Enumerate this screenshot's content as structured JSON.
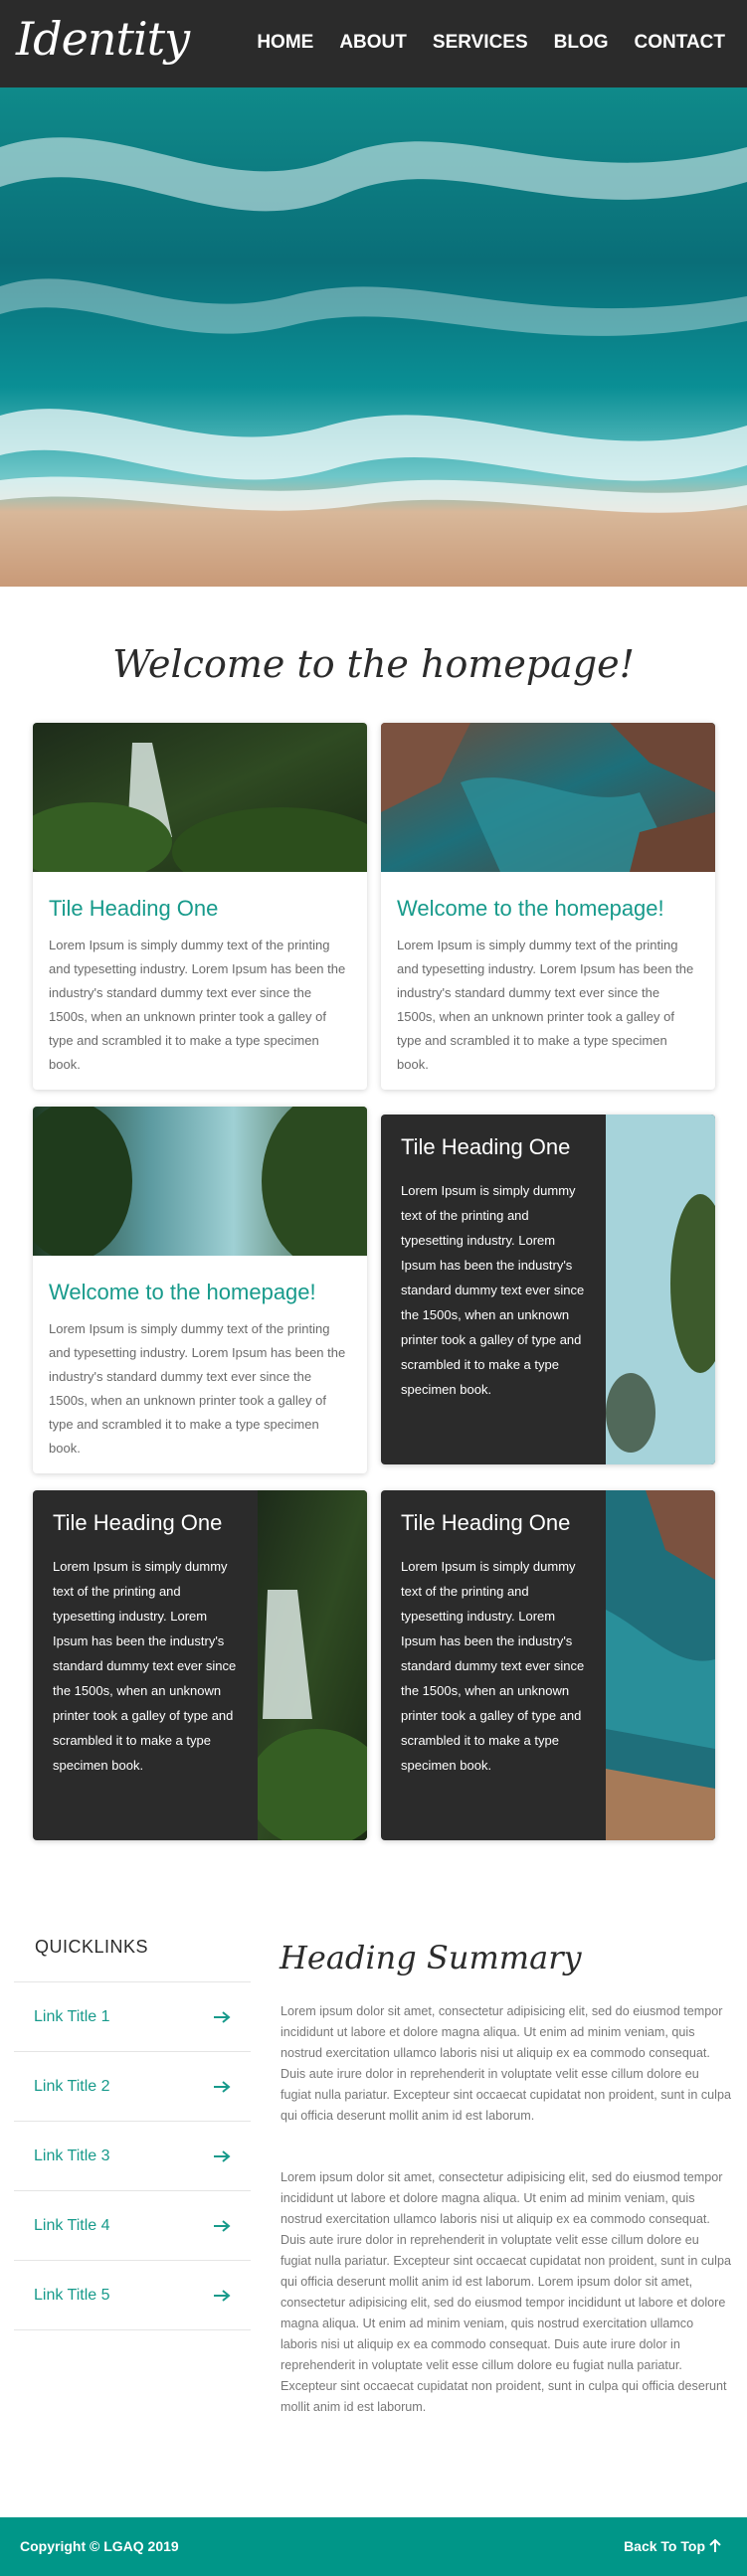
{
  "header": {
    "logo": "Identity",
    "nav": [
      "HOME",
      "ABOUT",
      "SERVICES",
      "BLOG",
      "CONTACT"
    ]
  },
  "welcome_title": "Welcome to the homepage!",
  "cards": [
    {
      "title": "Tile Heading One",
      "text": "Lorem Ipsum is simply dummy text of the printing and typesetting industry. Lorem Ipsum has been the industry's standard dummy text ever since the 1500s, when an unknown printer took a galley of type and scrambled it to make a type specimen book."
    },
    {
      "title": "Welcome to the homepage!",
      "text": "Lorem Ipsum is simply dummy text of the printing and typesetting industry. Lorem Ipsum has been the industry's standard dummy text ever since the 1500s, when an unknown printer took a galley of type and scrambled it to make a type specimen book."
    },
    {
      "title": "Welcome to the homepage!",
      "text": "Lorem Ipsum is simply dummy text of the printing and typesetting industry. Lorem Ipsum has been the industry's standard dummy text ever since the 1500s, when an unknown printer took a galley of type and scrambled it to make a type specimen book."
    }
  ],
  "dark_cards": [
    {
      "title": "Tile Heading One",
      "text": "Lorem Ipsum is simply dummy text of the printing and typesetting industry. Lorem Ipsum has been the industry's standard dummy text ever since the 1500s, when an unknown printer took a galley of type and scrambled it to make a type specimen book."
    },
    {
      "title": "Tile Heading One",
      "text": "Lorem Ipsum is simply dummy text of the printing and typesetting industry. Lorem Ipsum has been the industry's standard dummy text ever since the 1500s, when an unknown printer took a galley of type and scrambled it to make a type specimen book."
    },
    {
      "title": "Tile Heading One",
      "text": "Lorem Ipsum is simply dummy text of the printing and typesetting industry. Lorem Ipsum has been the industry's standard dummy text ever since the 1500s, when an unknown printer took a galley of type and scrambled it to make a type specimen book."
    }
  ],
  "quicklinks": {
    "title": "QUICKLINKS",
    "links": [
      "Link Title 1",
      "Link Title 2",
      "Link Title 3",
      "Link Title 4",
      "Link Title 5"
    ]
  },
  "summary": {
    "heading": "Heading Summary",
    "p1": "Lorem ipsum dolor sit amet, consectetur adipisicing elit, sed do eiusmod tempor incididunt ut labore et dolore magna aliqua. Ut enim ad minim veniam, quis nostrud exercitation ullamco laboris nisi ut aliquip ex ea commodo consequat. Duis aute irure dolor in reprehenderit in voluptate velit esse cillum dolore eu fugiat nulla pariatur. Excepteur sint occaecat cupidatat non proident, sunt in culpa qui officia deserunt mollit anim id est laborum.",
    "p2": "Lorem ipsum dolor sit amet, consectetur adipisicing elit, sed do eiusmod tempor incididunt ut labore et dolore magna aliqua. Ut enim ad minim veniam, quis nostrud exercitation ullamco laboris nisi ut aliquip ex ea commodo consequat. Duis aute irure dolor in reprehenderit in voluptate velit esse cillum dolore eu fugiat nulla pariatur. Excepteur sint occaecat cupidatat non proident, sunt in culpa qui officia deserunt mollit anim id est laborum. Lorem ipsum dolor sit amet, consectetur adipisicing elit, sed do eiusmod tempor incididunt ut labore et dolore magna aliqua. Ut enim ad minim veniam, quis nostrud exercitation ullamco laboris nisi ut aliquip ex ea commodo consequat. Duis aute irure dolor in reprehenderit in voluptate velit esse cillum dolore eu fugiat nulla pariatur. Excepteur sint occaecat cupidatat non proident, sunt in culpa qui officia deserunt mollit anim id est laborum."
  },
  "footer": {
    "copyright": "Copyright © LGAQ 2019",
    "back_to_top": "Back To Top"
  },
  "colors": {
    "accent": "#179a8b",
    "footer": "#009688",
    "dark": "#2b2b2b"
  }
}
